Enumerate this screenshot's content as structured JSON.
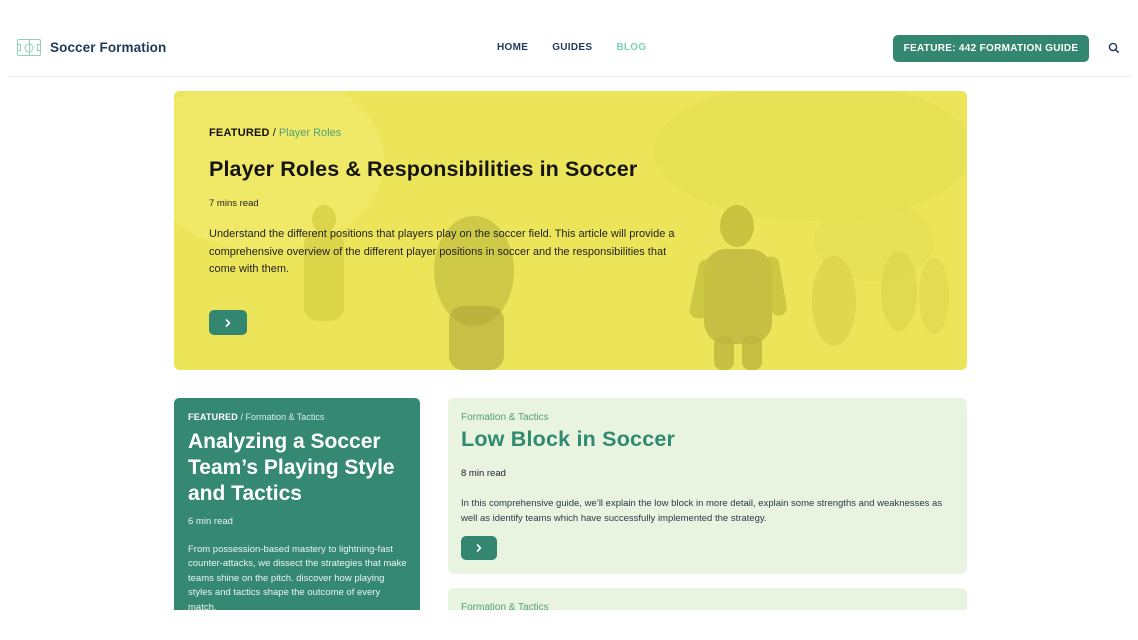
{
  "header": {
    "logo_text": "Soccer Formation",
    "logo_icon": "soccer-field-icon",
    "nav": [
      {
        "label": "HOME",
        "active": false
      },
      {
        "label": "GUIDES",
        "active": false
      },
      {
        "label": "BLOG",
        "active": true
      }
    ],
    "feature_button": "FEATURE: 442 FORMATION GUIDE",
    "search_icon": "search-icon"
  },
  "hero": {
    "kicker": "FEATURED",
    "separator": " / ",
    "category": "Player Roles",
    "title": "Player Roles & Responsibilities in Soccer",
    "read_time": "7 mins read",
    "description": "Understand the different positions that players play on the soccer field. This article will provide a comprehensive overview of the different player positions in soccer and the responsibilities that come with them.",
    "arrow_icon": "chevron-right-icon",
    "bg_color": "#ece55a"
  },
  "cards": [
    {
      "kicker": "FEATURED",
      "separator": " / ",
      "category": "Formation & Tactics",
      "title": "Analyzing a Soccer Team’s Playing Style and Tactics",
      "read_time": "6 min read",
      "description": "From possession-based mastery to lightning-fast counter-attacks, we dissect the strategies that make teams shine on the pitch. discover how playing styles and tactics shape the outcome of every match."
    },
    {
      "category": "Formation & Tactics",
      "title": "Low Block in Soccer",
      "read_time": "8 min read",
      "description": "In this comprehensive guide, we’ll explain the low block in more detail, explain some strengths and weaknesses as well as identify teams which have successfully implemented the strategy.",
      "arrow_icon": "chevron-right-icon"
    },
    {
      "category": "Formation & Tactics"
    }
  ],
  "colors": {
    "accent": "#33866f",
    "nav_active": "#7dd4b5",
    "card_green": "#358972",
    "card_light": "#e8f3e0"
  }
}
